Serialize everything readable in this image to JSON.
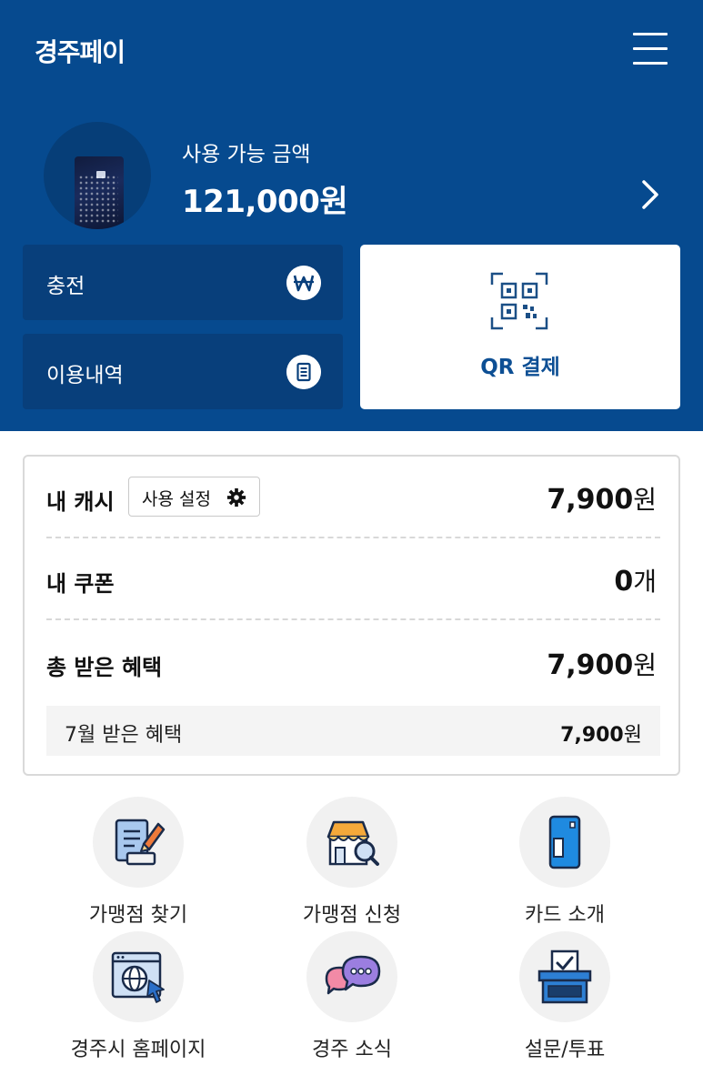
{
  "header": {
    "app_title": "경주페이",
    "balance_label": "사용 가능 금액",
    "balance_value": "121,000원",
    "charge_label": "충전",
    "history_label": "이용내역",
    "qr_label": "QR 결제"
  },
  "benefits": {
    "cash_label": "내 캐시",
    "usage_setting_label": "사용 설정",
    "cash_value": "7,900",
    "cash_unit": "원",
    "coupon_label": "내 쿠폰",
    "coupon_value": "0",
    "coupon_unit": "개",
    "total_label": "총 받은 혜택",
    "total_value": "7,900",
    "total_unit": "원",
    "month_label": "7월 받은 혜택",
    "month_value": "7,900",
    "month_unit": "원"
  },
  "menu": [
    {
      "label": "가맹점 찾기",
      "icon": "merchant-search-icon"
    },
    {
      "label": "가맹점 신청",
      "icon": "store-apply-icon"
    },
    {
      "label": "카드 소개",
      "icon": "card-intro-icon"
    },
    {
      "label": "경주시 홈페이지",
      "icon": "homepage-globe-icon"
    },
    {
      "label": "경주 소식",
      "icon": "news-chat-icon"
    },
    {
      "label": "설문/투표",
      "icon": "survey-vote-icon"
    }
  ],
  "colors": {
    "brand_blue": "#064a8f",
    "button_blue": "#083f7b",
    "qr_text": "#0d4f94"
  }
}
